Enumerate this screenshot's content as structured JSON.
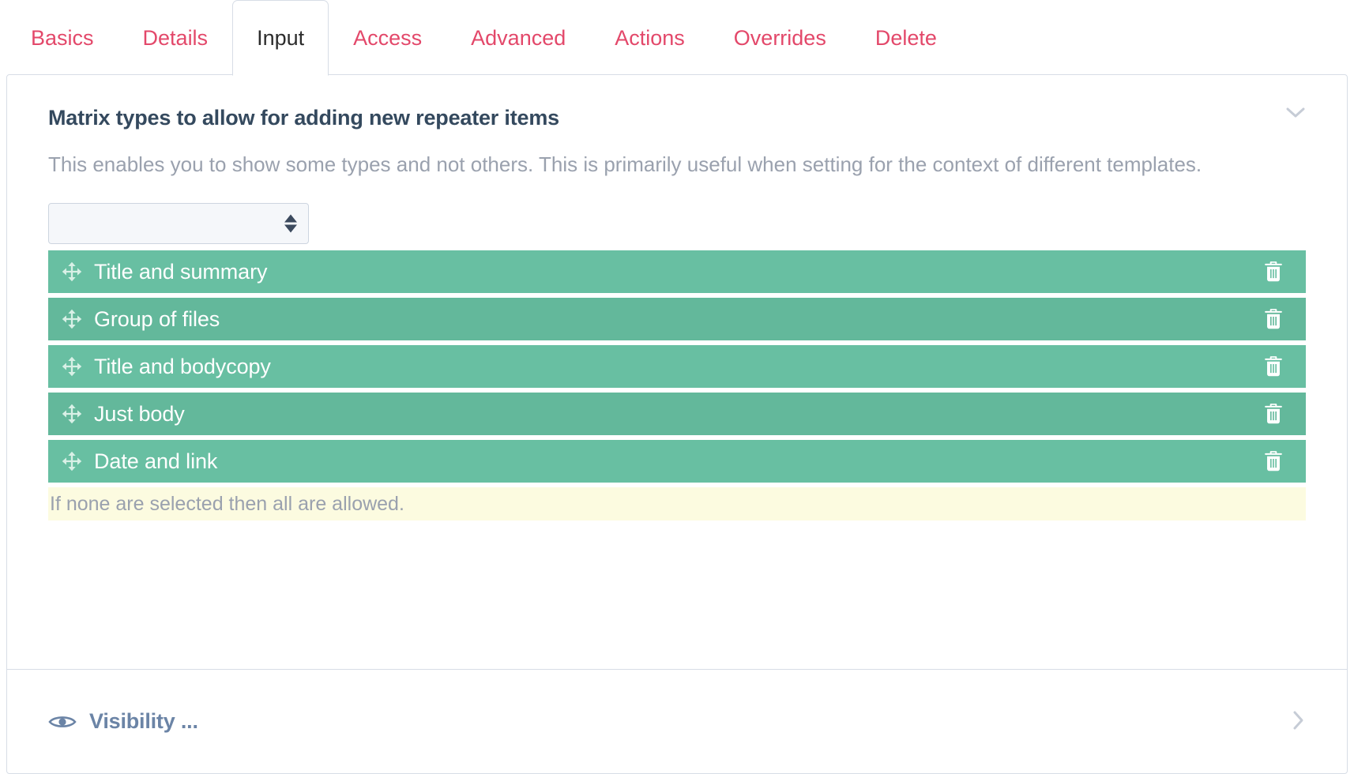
{
  "tabs": [
    {
      "label": "Basics",
      "active": false
    },
    {
      "label": "Details",
      "active": false
    },
    {
      "label": "Input",
      "active": true
    },
    {
      "label": "Access",
      "active": false
    },
    {
      "label": "Advanced",
      "active": false
    },
    {
      "label": "Actions",
      "active": false
    },
    {
      "label": "Overrides",
      "active": false
    },
    {
      "label": "Delete",
      "active": false
    }
  ],
  "section": {
    "title": "Matrix types to allow for adding new repeater items",
    "description": "This enables you to show some types and not others. This is primarily useful when setting for the context of different templates.",
    "collapse_icon": "chevron-down-icon",
    "collapse_glyph": "⌄"
  },
  "type_select": {
    "value": "",
    "placeholder": "",
    "icon": "select-stepper-icon"
  },
  "allowed_types": [
    {
      "label": "Title and summary",
      "handle_icon": "move-icon",
      "delete_icon": "trash-icon"
    },
    {
      "label": "Group of files",
      "handle_icon": "move-icon",
      "delete_icon": "trash-icon"
    },
    {
      "label": "Title and bodycopy",
      "handle_icon": "move-icon",
      "delete_icon": "trash-icon"
    },
    {
      "label": "Just body",
      "handle_icon": "move-icon",
      "delete_icon": "trash-icon"
    },
    {
      "label": "Date and link",
      "handle_icon": "move-icon",
      "delete_icon": "trash-icon"
    }
  ],
  "notice": {
    "text": "If none are selected then all are allowed."
  },
  "visibility": {
    "label": "Visibility ...",
    "icon": "eye-icon",
    "expand_icon": "chevron-right-icon",
    "expand_glyph": "›"
  },
  "colors": {
    "tab_inactive": "#e3486a",
    "tab_active_text": "#2c2c2c",
    "heading": "#34495e",
    "muted_text": "#9aa1ae",
    "row_green": "#68bfa2",
    "row_green_alt": "#63b89b",
    "notice_bg": "#fcfbe0",
    "visibility_text": "#6b84a6",
    "border": "#d7dde6",
    "select_bg": "#f5f7fa"
  }
}
